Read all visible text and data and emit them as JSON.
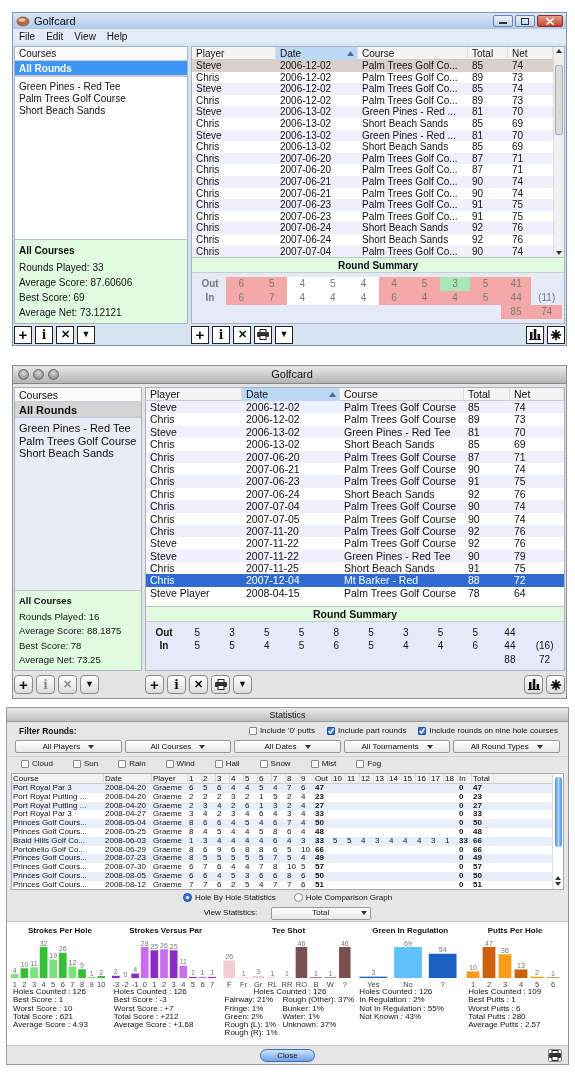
{
  "windows_golfcard_window": {
    "kind": "windows",
    "title": "Golfcard",
    "menu": [
      "File",
      "Edit",
      "View",
      "Help"
    ],
    "sidebar": {
      "header": "Courses",
      "items": [
        {
          "label": "All Rounds",
          "selected": true
        },
        {
          "label": "Green Pines - Red Tee",
          "selected": false
        },
        {
          "label": "Palm Trees Golf Course",
          "selected": false
        },
        {
          "label": "Short Beach Sands",
          "selected": false
        }
      ]
    },
    "course_summary": {
      "title": "All Courses",
      "lines": [
        "Rounds Played: 33",
        "Average Score: 87.60606",
        "Best Score: 69",
        "Average Net: 73.12121"
      ]
    },
    "table": {
      "columns": [
        {
          "label": "Player",
          "sorted": false
        },
        {
          "label": "Date",
          "sorted": true
        },
        {
          "label": "Course",
          "sorted": false
        },
        {
          "label": "Total",
          "sorted": false
        },
        {
          "label": "Net",
          "sorted": false
        }
      ],
      "rows": [
        {
          "cells": [
            "Steve",
            "2006-12-02",
            "Palm Trees Golf Co...",
            "85",
            "74"
          ],
          "selected": true
        },
        {
          "cells": [
            "Chris",
            "2006-12-02",
            "Palm Trees Golf Co...",
            "89",
            "73"
          ],
          "selected": false
        },
        {
          "cells": [
            "Steve",
            "2006-12-02",
            "Palm Trees Golf Co...",
            "85",
            "74"
          ],
          "selected": false
        },
        {
          "cells": [
            "Chris",
            "2006-12-02",
            "Palm Trees Golf Co...",
            "89",
            "73"
          ],
          "selected": false
        },
        {
          "cells": [
            "Steve",
            "2006-13-02",
            "Green Pines - Red ...",
            "81",
            "70"
          ],
          "selected": false
        },
        {
          "cells": [
            "Chris",
            "2006-13-02",
            "Short Beach Sands",
            "85",
            "69"
          ],
          "selected": false
        },
        {
          "cells": [
            "Steve",
            "2006-13-02",
            "Green Pines - Red ...",
            "81",
            "70"
          ],
          "selected": false
        },
        {
          "cells": [
            "Chris",
            "2006-13-02",
            "Short Beach Sands",
            "85",
            "69"
          ],
          "selected": false
        },
        {
          "cells": [
            "Chris",
            "2007-06-20",
            "Palm Trees Golf Co...",
            "87",
            "71"
          ],
          "selected": false
        },
        {
          "cells": [
            "Chris",
            "2007-06-20",
            "Palm Trees Golf Co...",
            "87",
            "71"
          ],
          "selected": false
        },
        {
          "cells": [
            "Chris",
            "2007-06-21",
            "Palm Trees Golf Co...",
            "90",
            "74"
          ],
          "selected": false
        },
        {
          "cells": [
            "Chris",
            "2007-06-21",
            "Palm Trees Golf Co...",
            "90",
            "74"
          ],
          "selected": false
        },
        {
          "cells": [
            "Chris",
            "2007-06-23",
            "Palm Trees Golf Co...",
            "91",
            "75"
          ],
          "selected": false
        },
        {
          "cells": [
            "Chris",
            "2007-06-23",
            "Palm Trees Golf Co...",
            "91",
            "75"
          ],
          "selected": false
        },
        {
          "cells": [
            "Chris",
            "2007-06-24",
            "Short Beach Sands",
            "92",
            "76"
          ],
          "selected": false
        },
        {
          "cells": [
            "Chris",
            "2007-06-24",
            "Short Beach Sands",
            "92",
            "76"
          ],
          "selected": false
        },
        {
          "cells": [
            "Chris",
            "2007-07-04",
            "Palm Trees Golf Co...",
            "90",
            "74"
          ],
          "selected": false
        }
      ]
    },
    "round_summary": {
      "title": "Round Summary",
      "rows": [
        {
          "label": "Out",
          "cells": [
            {
              "text": "6",
              "color": "#f5a8a8"
            },
            {
              "text": "5",
              "color": "#f5a8a8"
            },
            {
              "text": "4",
              "color": "#ffffff"
            },
            {
              "text": "5",
              "color": "#ffffff"
            },
            {
              "text": "4",
              "color": "#ffffff"
            },
            {
              "text": "4",
              "color": "#f5a8a8"
            },
            {
              "text": "5",
              "color": "#f5a8a8"
            },
            {
              "text": "3",
              "color": "#a8e8b8"
            },
            {
              "text": "5",
              "color": "#f5a8a8"
            },
            {
              "text": "41",
              "color": "#f5a8a8"
            }
          ]
        },
        {
          "label": "In",
          "cells": [
            {
              "text": "6",
              "color": "#f5a8a8"
            },
            {
              "text": "7",
              "color": "#f5a8a8"
            },
            {
              "text": "4",
              "color": "#ffffff"
            },
            {
              "text": "4",
              "color": "#ffffff"
            },
            {
              "text": "4",
              "color": "#ffffff"
            },
            {
              "text": "6",
              "color": "#f5a8a8"
            },
            {
              "text": "4",
              "color": "#f5a8a8"
            },
            {
              "text": "4",
              "color": "#f5a8a8"
            },
            {
              "text": "5",
              "color": "#f5a8a8"
            },
            {
              "text": "44",
              "color": "#f5a8a8"
            },
            {
              "text": "(11)"
            }
          ]
        }
      ],
      "totals": [
        {
          "text": "85",
          "color": "#f5a8a8"
        },
        {
          "text": "74",
          "color": "#f5a8a8"
        }
      ]
    },
    "left_toolbar": [
      {
        "kind": "add",
        "label": "+",
        "disabled": false
      },
      {
        "kind": "info",
        "label": "i",
        "disabled": false
      },
      {
        "kind": "delete",
        "label": "✕",
        "disabled": false
      },
      {
        "kind": "menu",
        "label": "▼",
        "disabled": false
      }
    ],
    "right_toolbar": [
      {
        "kind": "add",
        "label": "+"
      },
      {
        "kind": "info",
        "label": "i"
      },
      {
        "kind": "delete",
        "label": "✕"
      },
      {
        "kind": "print"
      },
      {
        "kind": "menu",
        "label": "▼"
      }
    ],
    "right_tools": [
      {
        "kind": "chart"
      },
      {
        "kind": "settings"
      }
    ]
  },
  "mac_golfcard_window": {
    "kind": "mac",
    "title": "Golfcard",
    "sidebar": {
      "header": "Courses",
      "items": [
        {
          "label": "All Rounds",
          "selected": true
        },
        {
          "label": "Green Pines - Red Tee",
          "selected": false
        },
        {
          "label": "Palm Trees Golf Course",
          "selected": false
        },
        {
          "label": "Short Beach Sands",
          "selected": false
        }
      ]
    },
    "course_summary": {
      "title": "All Courses",
      "lines": [
        "Rounds Played: 16",
        "Average Score: 88.1875",
        "Best Score: 78",
        "Average Net: 73.25"
      ]
    },
    "table": {
      "columns": [
        {
          "label": "Player",
          "sorted": false
        },
        {
          "label": "Date",
          "sorted": true
        },
        {
          "label": "Course",
          "sorted": false
        },
        {
          "label": "Total",
          "sorted": false
        },
        {
          "label": "Net",
          "sorted": false
        }
      ],
      "rows": [
        {
          "cells": [
            "Steve",
            "2006-12-02",
            "Palm Trees Golf Course",
            "85",
            "74"
          ],
          "selected": false
        },
        {
          "cells": [
            "Chris",
            "2006-12-02",
            "Palm Trees Golf Course",
            "89",
            "73"
          ],
          "selected": false
        },
        {
          "cells": [
            "Steve",
            "2006-13-02",
            "Green Pines - Red Tee",
            "81",
            "70"
          ],
          "selected": false
        },
        {
          "cells": [
            "Chris",
            "2006-13-02",
            "Short Beach Sands",
            "85",
            "69"
          ],
          "selected": false
        },
        {
          "cells": [
            "Chris",
            "2007-06-20",
            "Palm Trees Golf Course",
            "87",
            "71"
          ],
          "selected": false
        },
        {
          "cells": [
            "Chris",
            "2007-06-21",
            "Palm Trees Golf Course",
            "90",
            "74"
          ],
          "selected": false
        },
        {
          "cells": [
            "Chris",
            "2007-06-23",
            "Palm Trees Golf Course",
            "91",
            "75"
          ],
          "selected": false
        },
        {
          "cells": [
            "Chris",
            "2007-06-24",
            "Short Beach Sands",
            "92",
            "76"
          ],
          "selected": false
        },
        {
          "cells": [
            "Chris",
            "2007-07-04",
            "Palm Trees Golf Course",
            "90",
            "74"
          ],
          "selected": false
        },
        {
          "cells": [
            "Chris",
            "2007-07-05",
            "Palm Trees Golf Course",
            "90",
            "74"
          ],
          "selected": false
        },
        {
          "cells": [
            "Chris",
            "2007-11-20",
            "Palm Trees Golf Course",
            "92",
            "76"
          ],
          "selected": false
        },
        {
          "cells": [
            "Steve",
            "2007-11-22",
            "Palm Trees Golf Course",
            "92",
            "76"
          ],
          "selected": false
        },
        {
          "cells": [
            "Steve",
            "2007-11-22",
            "Green Pines - Red Tee",
            "90",
            "79"
          ],
          "selected": false
        },
        {
          "cells": [
            "Chris",
            "2007-11-25",
            "Short Beach Sands",
            "91",
            "75"
          ],
          "selected": false
        },
        {
          "cells": [
            "Chris",
            "2007-12-04",
            "Mt Barker - Red",
            "88",
            "72"
          ],
          "selected": true
        },
        {
          "cells": [
            "Steve Player",
            "2008-04-15",
            "Palm Trees Golf Course",
            "78",
            "64"
          ],
          "selected": false
        }
      ]
    },
    "round_summary": {
      "title": "Round Summary",
      "rows": [
        {
          "label": "Out",
          "cells": [
            {
              "text": "5"
            },
            {
              "text": "3"
            },
            {
              "text": "5"
            },
            {
              "text": "5"
            },
            {
              "text": "8"
            },
            {
              "text": "5"
            },
            {
              "text": "3"
            },
            {
              "text": "5"
            },
            {
              "text": "5"
            },
            {
              "text": "44"
            }
          ]
        },
        {
          "label": "In",
          "cells": [
            {
              "text": "5"
            },
            {
              "text": "5"
            },
            {
              "text": "4"
            },
            {
              "text": "5"
            },
            {
              "text": "6"
            },
            {
              "text": "5"
            },
            {
              "text": "4"
            },
            {
              "text": "4"
            },
            {
              "text": "6"
            },
            {
              "text": "44"
            },
            {
              "text": "(16)"
            }
          ]
        }
      ],
      "totals": [
        {
          "text": "88"
        },
        {
          "text": "72"
        }
      ]
    },
    "left_toolbar": [
      {
        "kind": "add",
        "label": "+",
        "disabled": false
      },
      {
        "kind": "info",
        "label": "i",
        "disabled": true
      },
      {
        "kind": "delete",
        "label": "✕",
        "disabled": true
      },
      {
        "kind": "menu",
        "label": "▼",
        "disabled": false
      }
    ],
    "right_toolbar": [
      {
        "kind": "add",
        "label": "+"
      },
      {
        "kind": "info",
        "label": "i"
      },
      {
        "kind": "delete",
        "label": "✕"
      },
      {
        "kind": "print"
      },
      {
        "kind": "menu",
        "label": "▼"
      }
    ],
    "right_tools": [
      {
        "kind": "chart"
      },
      {
        "kind": "settings"
      }
    ]
  },
  "statistics_window": {
    "title": "Statistics",
    "filter_label": "Filter Rounds:",
    "options": [
      {
        "label": "Include '0' putts",
        "checked": false
      },
      {
        "label": "Include part rounds",
        "checked": true
      },
      {
        "label": "Include rounds on nine hole courses",
        "checked": true
      }
    ],
    "filters": [
      "All Players",
      "All Courses",
      "All Dates",
      "All Tournaments",
      "All Round Types"
    ],
    "weather": [
      {
        "label": "Cloud",
        "checked": false
      },
      {
        "label": "Sun",
        "checked": false
      },
      {
        "label": "Rain",
        "checked": false
      },
      {
        "label": "Wind",
        "checked": false
      },
      {
        "label": "Hail",
        "checked": false
      },
      {
        "label": "Snow",
        "checked": false
      },
      {
        "label": "Mist",
        "checked": false
      },
      {
        "label": "Fog",
        "checked": false
      }
    ],
    "table": {
      "columns": [
        "Course",
        "Date",
        "Player",
        "1",
        "2",
        "3",
        "4",
        "5",
        "6",
        "7",
        "8",
        "9",
        "Out",
        "10",
        "11",
        "12",
        "13",
        "14",
        "15",
        "16",
        "17",
        "18",
        "In",
        "Total"
      ],
      "rows": [
        {
          "course": "Port Royal Par 3",
          "date": "2008-04-20",
          "player": "Graeme",
          "front": [
            "6",
            "5",
            "6",
            "4",
            "4",
            "5",
            "4",
            "7",
            "6"
          ],
          "out": "47",
          "in": "0",
          "total": "47"
        },
        {
          "course": "Port Royal Putting ...",
          "date": "2008-04-20",
          "player": "Graeme",
          "front": [
            "2",
            "2",
            "2",
            "3",
            "2",
            "1",
            "5",
            "2",
            "4"
          ],
          "out": "23",
          "in": "0",
          "total": "23"
        },
        {
          "course": "Port Royal Putting ...",
          "date": "2008-04-20",
          "player": "Graeme",
          "front": [
            "2",
            "3",
            "4",
            "2",
            "6",
            "1",
            "3",
            "2",
            "4"
          ],
          "out": "27",
          "in": "0",
          "total": "27"
        },
        {
          "course": "Port Royal Par 3",
          "date": "2008-04-27",
          "player": "Graeme",
          "front": [
            "3",
            "4",
            "2",
            "3",
            "4",
            "6",
            "4",
            "3",
            "4"
          ],
          "out": "33",
          "in": "0",
          "total": "33"
        },
        {
          "course": "Princes Golf Cours...",
          "date": "2008-05-04",
          "player": "Graeme",
          "front": [
            "8",
            "6",
            "6",
            "4",
            "5",
            "4",
            "6",
            "7",
            "4"
          ],
          "out": "50",
          "in": "0",
          "total": "50"
        },
        {
          "course": "Princes Golf Cours...",
          "date": "2008-05-25",
          "player": "Graeme",
          "front": [
            "8",
            "4",
            "5",
            "4",
            "4",
            "5",
            "8",
            "6",
            "4"
          ],
          "out": "48",
          "in": "0",
          "total": "48"
        },
        {
          "course": "Braid Hills Golf Co...",
          "date": "2008-06-03",
          "player": "Graeme",
          "front": [
            "1",
            "3",
            "4",
            "4",
            "4",
            "4",
            "6",
            "4",
            "3"
          ],
          "out": "33",
          "back": [
            "5",
            "5",
            "4",
            "3",
            "4",
            "4",
            "4",
            "3",
            "1"
          ],
          "in": "33",
          "total": "66"
        },
        {
          "course": "Portobello Golf Co...",
          "date": "2008-06-29",
          "player": "Graeme",
          "front": [
            "8",
            "6",
            "9",
            "6",
            "8",
            "8",
            "6",
            "5",
            "10"
          ],
          "out": "66",
          "in": "0",
          "total": "66"
        },
        {
          "course": "Princes Golf Cours...",
          "date": "2008-07-23",
          "player": "Graeme",
          "front": [
            "8",
            "5",
            "5",
            "5",
            "5",
            "5",
            "7",
            "5",
            "4"
          ],
          "out": "49",
          "in": "0",
          "total": "49"
        },
        {
          "course": "Princes Golf Cours...",
          "date": "2008-07-30",
          "player": "Graeme",
          "front": [
            "6",
            "7",
            "6",
            "4",
            "4",
            "7",
            "8",
            "10",
            "5"
          ],
          "out": "57",
          "in": "0",
          "total": "57"
        },
        {
          "course": "Princes Golf Cours...",
          "date": "2008-08-05",
          "player": "Graeme",
          "front": [
            "6",
            "6",
            "4",
            "5",
            "3",
            "6",
            "6",
            "8",
            "6"
          ],
          "out": "50",
          "in": "0",
          "total": "50"
        },
        {
          "course": "Princes Golf Cours...",
          "date": "2008-08-12",
          "player": "Graeme",
          "front": [
            "7",
            "7",
            "6",
            "2",
            "5",
            "4",
            "7",
            "7",
            "6"
          ],
          "out": "51",
          "in": "0",
          "total": "51"
        }
      ]
    },
    "view_modes": [
      {
        "label": "Hole By Hole Statistics",
        "selected": true
      },
      {
        "label": "Hole Comparison Graph",
        "selected": false
      }
    ],
    "view_statistics": {
      "label": "View Statistics:",
      "value": "Total"
    },
    "charts": [
      {
        "chart_data": {
          "type": "bar",
          "title": "Strokes Per Hole",
          "categories": [
            "1",
            "2",
            "3",
            "4",
            "5",
            "6",
            "7",
            "8",
            "9",
            "10"
          ],
          "series": [
            {
              "color": "#7be37b",
              "values": [
                4,
                null,
                11,
                null,
                19,
                null,
                12,
                null,
                1,
                null
              ]
            },
            {
              "color": "#35c035",
              "values": [
                null,
                10,
                null,
                32,
                null,
                26,
                null,
                9,
                null,
                2
              ]
            }
          ],
          "data_labels": true
        },
        "stats": [
          [
            "Holes Counted : 126",
            "Best Score : 1",
            "Worst Score : 10",
            "Total Score : 621",
            "Average Score : 4.93"
          ]
        ]
      },
      {
        "chart_data": {
          "type": "bar",
          "title": "Strokes Versus Par",
          "categories": [
            "-3",
            "-2",
            "-1",
            "0",
            "1",
            "2",
            "3",
            "4",
            "5",
            "6",
            "7"
          ],
          "series": [
            {
              "color": "#8c2cc8",
              "values": [
                2,
                null,
                4,
                null,
                25,
                null,
                25,
                null,
                1,
                null,
                1
              ]
            },
            {
              "color": "#c86cf0",
              "values": [
                null,
                0,
                null,
                28,
                null,
                26,
                null,
                11,
                null,
                1,
                null
              ]
            }
          ],
          "data_labels": true
        },
        "stats": [
          [
            "Holes Counted : 126",
            "Best Score : -3",
            "Worst Score : +7",
            "Total Score : +212",
            "Average Score : +1.68"
          ]
        ]
      },
      {
        "chart_data": {
          "type": "bar",
          "title": "Tee Shot",
          "categories": [
            "F",
            "Fr",
            "Gr",
            "RL",
            "RR",
            "RO",
            "B",
            "W",
            "?"
          ],
          "series": [
            {
              "color": "#f2cdd3",
              "values": [
                26,
                1,
                3,
                1,
                1,
                null,
                null,
                null,
                null
              ]
            },
            {
              "color": "#7a5050",
              "values": [
                null,
                null,
                null,
                null,
                null,
                46,
                1,
                1,
                46
              ]
            }
          ],
          "data_labels": true
        },
        "stats_heading": "Holes Counted : 126",
        "stats": [
          [
            "Fairway: 21%",
            "Fringe: 1%",
            "Green: 2%",
            "Rough (L): 1%",
            "Rough (R): 1%"
          ],
          [
            "Rough (Other): 37%",
            "Bunker: 1%",
            "Water: 1%",
            "Unknown: 37%"
          ]
        ]
      },
      {
        "chart_data": {
          "type": "bar",
          "title": "Green In Regulation",
          "categories": [
            "Yes",
            "No",
            "?"
          ],
          "series": [
            {
              "color": "#1a62c0",
              "values": [
                3,
                null,
                54
              ]
            },
            {
              "color": "#5ec2f8",
              "values": [
                null,
                69,
                null
              ]
            }
          ],
          "data_labels": true
        },
        "stats": [
          [
            "Holes Counted : 126",
            "In Regulation : 2%",
            "Not In Regulation : 55%",
            "Not Known : 43%"
          ]
        ]
      },
      {
        "chart_data": {
          "type": "bar",
          "title": "Putts Per Hole",
          "categories": [
            "1",
            "2",
            "3",
            "4",
            "5",
            "6"
          ],
          "series": [
            {
              "color": "#f89c1c",
              "values": [
                10,
                null,
                36,
                null,
                2,
                null
              ]
            },
            {
              "color": "#cc6210",
              "values": [
                null,
                47,
                null,
                13,
                null,
                1
              ]
            }
          ],
          "data_labels": true
        },
        "stats": [
          [
            "Holes Counted : 109",
            "Best Putts : 1",
            "Worst Putts : 6",
            "Total Putts : 280",
            "Average Putts : 2.57"
          ]
        ]
      }
    ],
    "close_button": "Close"
  }
}
